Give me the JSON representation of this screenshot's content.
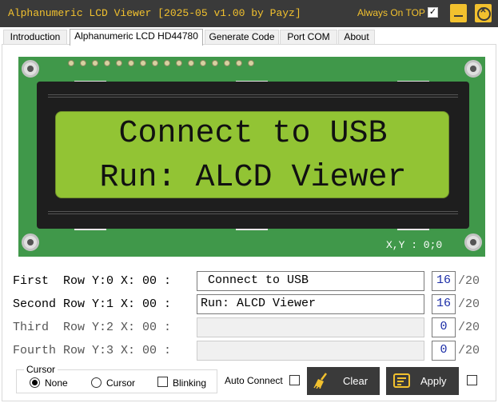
{
  "window": {
    "title": "Alphanumeric LCD Viewer [2025-05 v1.00 by Payz]",
    "always_on_top_label": "Always On TOP",
    "always_on_top_checked": "✓",
    "accent_color": "#f2c12e",
    "titlebar_color": "#3a3a3a"
  },
  "tabs": [
    {
      "label": "Introduction"
    },
    {
      "label": "Alphanumeric LCD HD44780"
    },
    {
      "label": "Generate Code"
    },
    {
      "label": "Port COM"
    },
    {
      "label": "About"
    }
  ],
  "lcd": {
    "line1": "Connect to USB",
    "line2": "Run: ALCD Viewer",
    "coord_readout": "X,Y : 0;0",
    "screen_color": "#92c434",
    "board_color": "#40984a"
  },
  "rows": [
    {
      "label": "First  Row Y:0 X: 00 :",
      "value": " Connect to USB",
      "count": "16",
      "max": "/20"
    },
    {
      "label": "Second Row Y:1 X: 00 :",
      "value": "Run: ALCD Viewer",
      "count": "16",
      "max": "/20"
    },
    {
      "label": "Third  Row Y:2 X: 00 :",
      "value": "",
      "count": "0",
      "max": "/20"
    },
    {
      "label": "Fourth Row Y:3 X: 00 :",
      "value": "",
      "count": "0",
      "max": "/20"
    }
  ],
  "cursor": {
    "legend": "Cursor",
    "none_label": "None",
    "cursor_label": "Cursor",
    "blinking_label": "Blinking",
    "selected": "None"
  },
  "auto_connect_label": "Auto Connect",
  "buttons": {
    "clear_label": "Clear",
    "apply_label": "Apply"
  }
}
